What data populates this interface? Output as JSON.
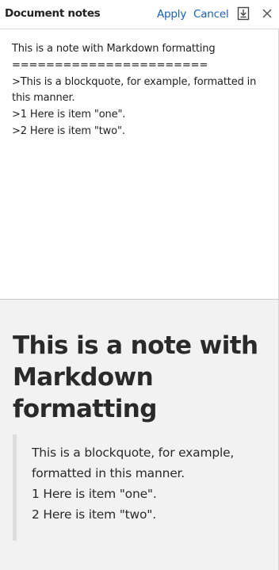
{
  "header": {
    "title": "Document notes",
    "apply_label": "Apply",
    "cancel_label": "Cancel",
    "download_icon": "download-icon",
    "close_icon": "close-icon",
    "accent_color": "#1a5fb4"
  },
  "editor": {
    "lines": [
      "This is a note with Markdown formatting",
      "=======================",
      ">This is a blockquote, for example, formatted in this manner.",
      ">1 Here is item \"one\".",
      ">2 Here is item \"two\"."
    ]
  },
  "preview": {
    "heading": "This is a note with Markdown formatting",
    "blockquote": {
      "text": "This is a blockquote, for example, formatted in this manner.",
      "item_one": "1 Here is item \"one\".",
      "item_two": "2 Here is item \"two\"."
    }
  }
}
